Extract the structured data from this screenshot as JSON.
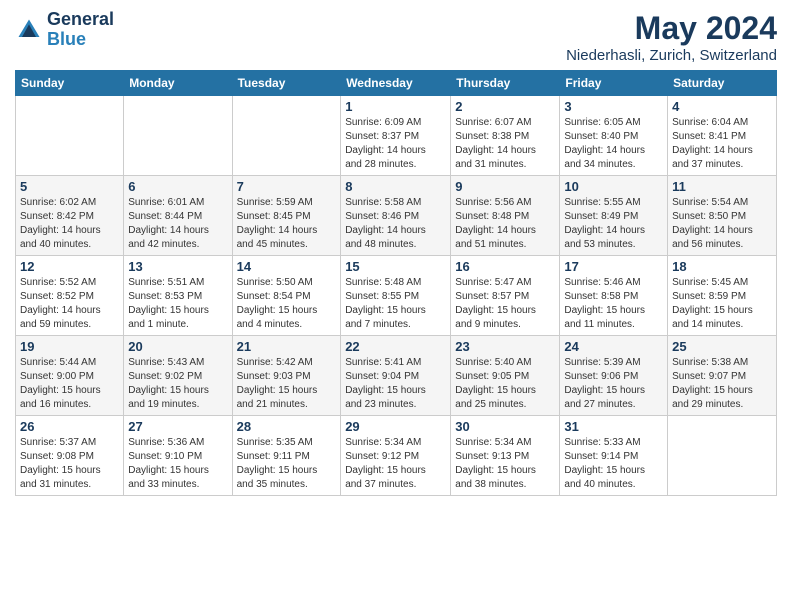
{
  "logo": {
    "line1": "General",
    "line2": "Blue"
  },
  "title": "May 2024",
  "subtitle": "Niederhasli, Zurich, Switzerland",
  "weekdays": [
    "Sunday",
    "Monday",
    "Tuesday",
    "Wednesday",
    "Thursday",
    "Friday",
    "Saturday"
  ],
  "weeks": [
    [
      {
        "day": "",
        "info": ""
      },
      {
        "day": "",
        "info": ""
      },
      {
        "day": "",
        "info": ""
      },
      {
        "day": "1",
        "info": "Sunrise: 6:09 AM\nSunset: 8:37 PM\nDaylight: 14 hours\nand 28 minutes."
      },
      {
        "day": "2",
        "info": "Sunrise: 6:07 AM\nSunset: 8:38 PM\nDaylight: 14 hours\nand 31 minutes."
      },
      {
        "day": "3",
        "info": "Sunrise: 6:05 AM\nSunset: 8:40 PM\nDaylight: 14 hours\nand 34 minutes."
      },
      {
        "day": "4",
        "info": "Sunrise: 6:04 AM\nSunset: 8:41 PM\nDaylight: 14 hours\nand 37 minutes."
      }
    ],
    [
      {
        "day": "5",
        "info": "Sunrise: 6:02 AM\nSunset: 8:42 PM\nDaylight: 14 hours\nand 40 minutes."
      },
      {
        "day": "6",
        "info": "Sunrise: 6:01 AM\nSunset: 8:44 PM\nDaylight: 14 hours\nand 42 minutes."
      },
      {
        "day": "7",
        "info": "Sunrise: 5:59 AM\nSunset: 8:45 PM\nDaylight: 14 hours\nand 45 minutes."
      },
      {
        "day": "8",
        "info": "Sunrise: 5:58 AM\nSunset: 8:46 PM\nDaylight: 14 hours\nand 48 minutes."
      },
      {
        "day": "9",
        "info": "Sunrise: 5:56 AM\nSunset: 8:48 PM\nDaylight: 14 hours\nand 51 minutes."
      },
      {
        "day": "10",
        "info": "Sunrise: 5:55 AM\nSunset: 8:49 PM\nDaylight: 14 hours\nand 53 minutes."
      },
      {
        "day": "11",
        "info": "Sunrise: 5:54 AM\nSunset: 8:50 PM\nDaylight: 14 hours\nand 56 minutes."
      }
    ],
    [
      {
        "day": "12",
        "info": "Sunrise: 5:52 AM\nSunset: 8:52 PM\nDaylight: 14 hours\nand 59 minutes."
      },
      {
        "day": "13",
        "info": "Sunrise: 5:51 AM\nSunset: 8:53 PM\nDaylight: 15 hours\nand 1 minute."
      },
      {
        "day": "14",
        "info": "Sunrise: 5:50 AM\nSunset: 8:54 PM\nDaylight: 15 hours\nand 4 minutes."
      },
      {
        "day": "15",
        "info": "Sunrise: 5:48 AM\nSunset: 8:55 PM\nDaylight: 15 hours\nand 7 minutes."
      },
      {
        "day": "16",
        "info": "Sunrise: 5:47 AM\nSunset: 8:57 PM\nDaylight: 15 hours\nand 9 minutes."
      },
      {
        "day": "17",
        "info": "Sunrise: 5:46 AM\nSunset: 8:58 PM\nDaylight: 15 hours\nand 11 minutes."
      },
      {
        "day": "18",
        "info": "Sunrise: 5:45 AM\nSunset: 8:59 PM\nDaylight: 15 hours\nand 14 minutes."
      }
    ],
    [
      {
        "day": "19",
        "info": "Sunrise: 5:44 AM\nSunset: 9:00 PM\nDaylight: 15 hours\nand 16 minutes."
      },
      {
        "day": "20",
        "info": "Sunrise: 5:43 AM\nSunset: 9:02 PM\nDaylight: 15 hours\nand 19 minutes."
      },
      {
        "day": "21",
        "info": "Sunrise: 5:42 AM\nSunset: 9:03 PM\nDaylight: 15 hours\nand 21 minutes."
      },
      {
        "day": "22",
        "info": "Sunrise: 5:41 AM\nSunset: 9:04 PM\nDaylight: 15 hours\nand 23 minutes."
      },
      {
        "day": "23",
        "info": "Sunrise: 5:40 AM\nSunset: 9:05 PM\nDaylight: 15 hours\nand 25 minutes."
      },
      {
        "day": "24",
        "info": "Sunrise: 5:39 AM\nSunset: 9:06 PM\nDaylight: 15 hours\nand 27 minutes."
      },
      {
        "day": "25",
        "info": "Sunrise: 5:38 AM\nSunset: 9:07 PM\nDaylight: 15 hours\nand 29 minutes."
      }
    ],
    [
      {
        "day": "26",
        "info": "Sunrise: 5:37 AM\nSunset: 9:08 PM\nDaylight: 15 hours\nand 31 minutes."
      },
      {
        "day": "27",
        "info": "Sunrise: 5:36 AM\nSunset: 9:10 PM\nDaylight: 15 hours\nand 33 minutes."
      },
      {
        "day": "28",
        "info": "Sunrise: 5:35 AM\nSunset: 9:11 PM\nDaylight: 15 hours\nand 35 minutes."
      },
      {
        "day": "29",
        "info": "Sunrise: 5:34 AM\nSunset: 9:12 PM\nDaylight: 15 hours\nand 37 minutes."
      },
      {
        "day": "30",
        "info": "Sunrise: 5:34 AM\nSunset: 9:13 PM\nDaylight: 15 hours\nand 38 minutes."
      },
      {
        "day": "31",
        "info": "Sunrise: 5:33 AM\nSunset: 9:14 PM\nDaylight: 15 hours\nand 40 minutes."
      },
      {
        "day": "",
        "info": ""
      }
    ]
  ]
}
